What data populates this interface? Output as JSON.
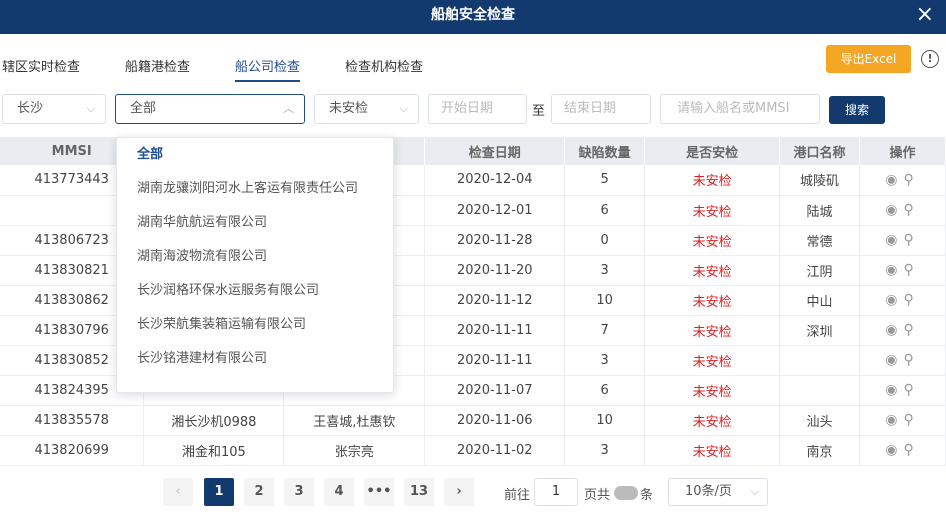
{
  "window": {
    "title": "船舶安全检查"
  },
  "tabs": [
    {
      "label": "辖区实时检查"
    },
    {
      "label": "船籍港检查"
    },
    {
      "label": "船公司检查"
    },
    {
      "label": "检查机构检查"
    }
  ],
  "toolbar": {
    "export_label": "导出Excel"
  },
  "filters": {
    "city": "长沙",
    "company": "全部",
    "status": "未安检",
    "start_placeholder": "开始日期",
    "to_label": "至",
    "end_placeholder": "结束日期",
    "ship_placeholder": "请输入船名或MMSI",
    "search_label": "搜索"
  },
  "dropdown": {
    "items": [
      "全部",
      "湖南龙骧浏阳河水上客运有限责任公司",
      "湖南华航航运有限公司",
      "湖南海波物流有限公司",
      "长沙润格环保水运服务有限公司",
      "长沙荣航集装箱运输有限公司",
      "长沙铭港建材有限公司"
    ]
  },
  "table": {
    "headers": [
      "MMSI",
      "",
      "",
      "检查日期",
      "缺陷数量",
      "是否安检",
      "港口名称",
      "操作"
    ],
    "rows": [
      {
        "mmsi": "413773443",
        "name": "",
        "person": "",
        "date": "2020-12-04",
        "defects": "5",
        "status": "未安检",
        "port": "城陵矶"
      },
      {
        "mmsi": "",
        "name": "",
        "person": "",
        "date": "2020-12-01",
        "defects": "6",
        "status": "未安检",
        "port": "陆城"
      },
      {
        "mmsi": "413806723",
        "name": "",
        "person": "",
        "date": "2020-11-28",
        "defects": "0",
        "status": "未安检",
        "port": "常德"
      },
      {
        "mmsi": "413830821",
        "name": "",
        "person": "",
        "date": "2020-11-20",
        "defects": "3",
        "status": "未安检",
        "port": "江阴"
      },
      {
        "mmsi": "413830862",
        "name": "",
        "person": "",
        "date": "2020-11-12",
        "defects": "10",
        "status": "未安检",
        "port": "中山"
      },
      {
        "mmsi": "413830796",
        "name": "",
        "person": "",
        "date": "2020-11-11",
        "defects": "7",
        "status": "未安检",
        "port": "深圳"
      },
      {
        "mmsi": "413830852",
        "name": "",
        "person": "",
        "date": "2020-11-11",
        "defects": "3",
        "status": "未安检",
        "port": ""
      },
      {
        "mmsi": "413824395",
        "name": "",
        "person": "",
        "date": "2020-11-07",
        "defects": "6",
        "status": "未安检",
        "port": ""
      },
      {
        "mmsi": "413835578",
        "name": "湘长沙机0988",
        "person": "王喜城,杜惠钦",
        "date": "2020-11-06",
        "defects": "10",
        "status": "未安检",
        "port": "汕头"
      },
      {
        "mmsi": "413820699",
        "name": "湘金和105",
        "person": "张宗亮",
        "date": "2020-11-02",
        "defects": "3",
        "status": "未安检",
        "port": "南京"
      }
    ]
  },
  "pager": {
    "pages": [
      "1",
      "2",
      "3",
      "4",
      "•••",
      "13"
    ],
    "goto_label": "前往",
    "goto_value": "1",
    "page_total_label": "页共",
    "count_unit": "条",
    "page_size": "10条/页"
  },
  "colors": {
    "primary": "#123a6e",
    "accent": "#f5a623",
    "danger": "#e02020"
  }
}
